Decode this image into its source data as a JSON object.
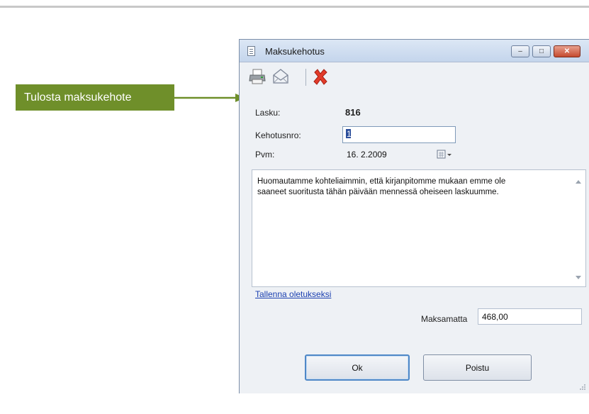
{
  "callout": {
    "label": "Tulosta maksukehote",
    "color": "#6f8f2a"
  },
  "window": {
    "title": "Maksukehotus",
    "title_icon": "document-icon",
    "controls": {
      "minimize": "–",
      "maximize": "□",
      "close": "✕"
    }
  },
  "toolbar": {
    "icons": [
      "printer-icon",
      "envelope-icon",
      "delete-icon"
    ]
  },
  "form": {
    "lasku_label": "Lasku:",
    "lasku_value": "816",
    "kehotusnro_label": "Kehotusnro:",
    "kehotusnro_value": "1",
    "pvm_label": "Pvm:",
    "pvm_value": "16.  2.2009",
    "message_line1": "Huomautamme kohteliaimmin, että kirjanpitomme mukaan emme ole",
    "message_line2": "saaneet suoritusta tähän päivään mennessä oheiseen laskuumme.",
    "save_default_link": "Tallenna oletukseksi",
    "maksamatta_label": "Maksamatta",
    "maksamatta_value": "468,00"
  },
  "buttons": {
    "ok": "Ok",
    "poistu": "Poistu"
  },
  "colors": {
    "link": "#1a3fb0",
    "close_button": "#c54a2f",
    "focus_border": "#4f88c7"
  }
}
